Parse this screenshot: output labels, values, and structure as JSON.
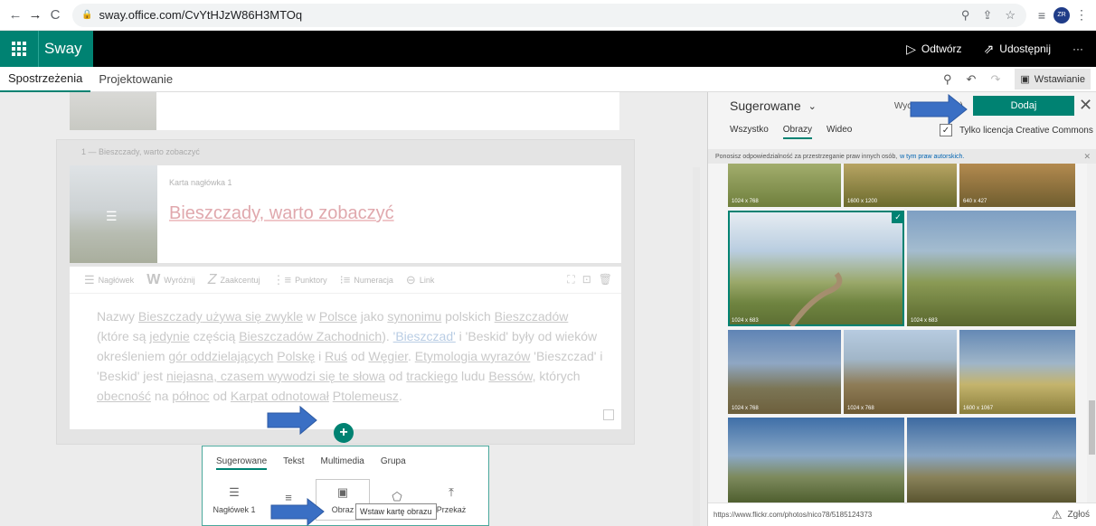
{
  "browser": {
    "url": "sway.office.com/CvYtHJzW86H3MTOq",
    "avatar_text": "ZR"
  },
  "appbar": {
    "app_name": "Sway",
    "play_label": "Odtwórz",
    "share_label": "Udostępnij",
    "more_label": "···"
  },
  "ribbon": {
    "tabs": [
      "Spostrzeżenia",
      "Projektowanie"
    ],
    "insert_label": "Wstawianie"
  },
  "story": {
    "group_label": "1 — Bieszczady, warto zobaczyć",
    "heading_kicker": "Karta nagłówka 1",
    "heading_title": "Bieszczady, warto zobaczyć",
    "toolbar": {
      "heading": "Nagłówek",
      "emphasize": "Wyróżnij",
      "accent": "Zaakcentuj",
      "bullets": "Punktory",
      "numbering": "Numeracja",
      "link": "Link"
    },
    "paragraph": {
      "p1": "Nazwy ",
      "p2": "Bieszczady",
      "p3": " używa się ",
      "p4": "zwykle",
      "p5": " w ",
      "p6": "Polsce",
      "p7": " jako ",
      "p8": "synonimu",
      "p9": " polskich ",
      "p10": "Bieszczadów",
      "p11": " (które są ",
      "p12": "jedynie",
      "p13": " częścią ",
      "p14": "Bieszczadów Zachodnich",
      "p15": "). ",
      "p16": "'Bieszczad'",
      "p17": " i 'Beskid' były od wieków określeniem ",
      "p18": "gór oddzielających",
      "p19": " ",
      "p20": "Polskę",
      "p21": " i ",
      "p22": "Ruś",
      "p23": " od ",
      "p24": "Węgier",
      "p25": ". ",
      "p26": "Etymologia wyrazów",
      "p27": " 'Bieszczad' i 'Beskid' jest ",
      "p28": "niejasna, czasem wywodzi się te słowa",
      "p29": " od ",
      "p30": "trackiego",
      "p31": " ludu ",
      "p32": "Bessów",
      "p33": ", których ",
      "p34": "obecność",
      "p35": " na ",
      "p36": "północ",
      "p37": " od ",
      "p38": "Karpat odnotował",
      "p39": " ",
      "p40": "Ptolemeusz",
      "p41": "."
    }
  },
  "insert_popup": {
    "tabs": [
      "Sugerowane",
      "Tekst",
      "Multimedia",
      "Grupa"
    ],
    "items": [
      "Nagłówek 1",
      "",
      "Obraz",
      "",
      "Przekaż"
    ],
    "tooltip": "Wstaw kartę obrazu"
  },
  "pane": {
    "suggested_label": "Sugerowane",
    "clear_label": "Wyczyść",
    "clear_count": "1)",
    "add_label": "Dodaj",
    "filter_tabs": [
      "Wszystko",
      "Obrazy",
      "Wideo"
    ],
    "cc_label": "Tylko licencja Creative Commons",
    "notice_text": "Ponosisz odpowiedzialność za przestrzeganie praw innych osób,",
    "notice_link": "w tym praw autorskich.",
    "images": [
      {
        "dim": "1024 x 768"
      },
      {
        "dim": "1600 x 1200"
      },
      {
        "dim": "640 x 427"
      },
      {
        "dim": "1024 x 683"
      },
      {
        "dim": "1024 x 683"
      },
      {
        "dim": "1024 x 768"
      },
      {
        "dim": "1024 x 768"
      },
      {
        "dim": "1600 x 1067"
      },
      {
        "dim": ""
      },
      {
        "dim": ""
      }
    ],
    "footer_url": "https://www.flickr.com/photos/nico78/5185124373",
    "report_label": "Zgłoś"
  },
  "colors": {
    "accent": "#008272",
    "arrow": "#3a6fc4"
  }
}
